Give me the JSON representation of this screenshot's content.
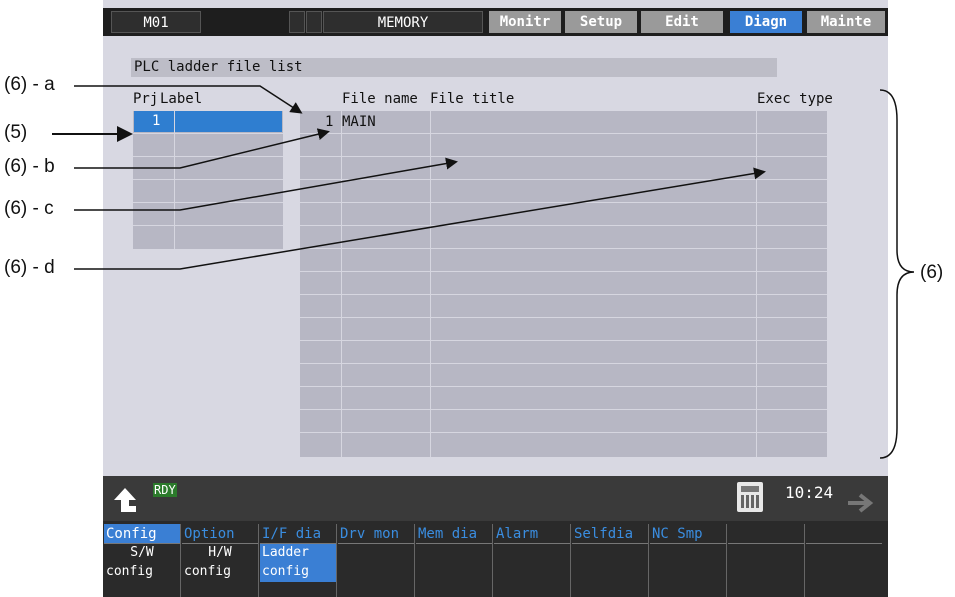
{
  "topbar": {
    "mode": "M01",
    "memory": "MEMORY",
    "tabs": [
      "Monitr",
      "Setup",
      "Edit",
      "Diagn",
      "Mainte"
    ],
    "active_tab": "Diagn"
  },
  "panel": {
    "title": "PLC ladder file list",
    "left_headers": {
      "prj": "Prj",
      "label": "Label"
    },
    "right_headers": {
      "file_name": "File name",
      "file_title": "File title",
      "exec_type": "Exec type"
    },
    "left_rows": [
      {
        "prj": "1",
        "label": ""
      }
    ],
    "right_rows": [
      {
        "no": "1",
        "file_name": "MAIN",
        "file_title": "",
        "exec_type": ""
      }
    ]
  },
  "status": {
    "ready": "RDY",
    "time": "10:24"
  },
  "menu": {
    "top": [
      "Config",
      "Option",
      "I/F dia",
      "Drv mon",
      "Mem dia",
      "Alarm",
      "Selfdia",
      "NC Smp",
      "",
      ""
    ],
    "sub": [
      {
        "line1": "S/W",
        "line2": "config"
      },
      {
        "line1": "H/W",
        "line2": "config"
      },
      {
        "line1": "Ladder",
        "line2": "config"
      }
    ]
  },
  "annotations": {
    "a": "(6) - a",
    "five": "(5)",
    "b": "(6) - b",
    "c": "(6) - c",
    "d": "(6) - d",
    "six": "(6)"
  },
  "colors": {
    "accent": "#3a7fd4",
    "ready_badge": "#2b7a2b",
    "grid": "#b7b7c4",
    "screen": "#d8d8e2"
  },
  "icons": {
    "up": "up-arrow-icon",
    "forward": "right-arrow-icon",
    "calculator": "calculator-icon"
  }
}
